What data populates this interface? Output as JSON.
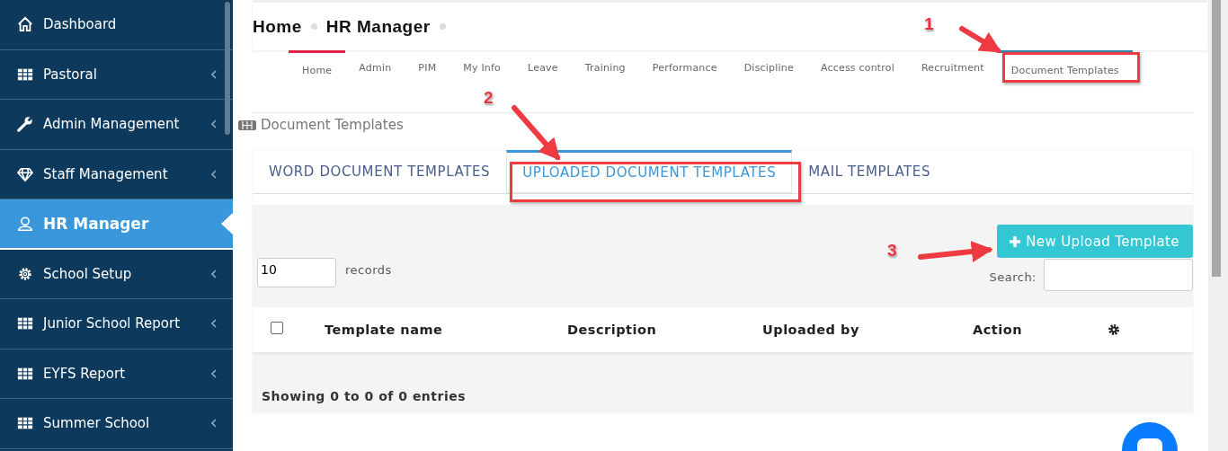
{
  "sidebar": {
    "items": [
      {
        "label": "Dashboard",
        "kind": "home",
        "expandable": false,
        "selected": false
      },
      {
        "label": "Pastoral",
        "kind": "grid",
        "expandable": true,
        "selected": false
      },
      {
        "label": "Admin Management",
        "kind": "wrench",
        "expandable": true,
        "selected": false
      },
      {
        "label": "Staff Management",
        "kind": "diamond",
        "expandable": true,
        "selected": false
      },
      {
        "label": "HR Manager",
        "kind": "user",
        "expandable": false,
        "selected": true
      },
      {
        "label": "School Setup",
        "kind": "gear",
        "expandable": true,
        "selected": false
      },
      {
        "label": "Junior School Report",
        "kind": "grid",
        "expandable": true,
        "selected": false
      },
      {
        "label": "EYFS Report",
        "kind": "grid",
        "expandable": true,
        "selected": false
      },
      {
        "label": "Summer School",
        "kind": "grid",
        "expandable": true,
        "selected": false
      }
    ]
  },
  "breadcrumb": [
    "Home",
    "HR Manager"
  ],
  "nav_tabs": [
    {
      "label": "Home",
      "accent": true,
      "selected": false
    },
    {
      "label": "Admin",
      "accent": false,
      "selected": false
    },
    {
      "label": "PIM",
      "accent": false,
      "selected": false
    },
    {
      "label": "My Info",
      "accent": false,
      "selected": false
    },
    {
      "label": "Leave",
      "accent": false,
      "selected": false
    },
    {
      "label": "Training",
      "accent": false,
      "selected": false
    },
    {
      "label": "Performance",
      "accent": false,
      "selected": false
    },
    {
      "label": "Discipline",
      "accent": false,
      "selected": false
    },
    {
      "label": "Access control",
      "accent": false,
      "selected": false
    },
    {
      "label": "Recruitment",
      "accent": false,
      "selected": false
    },
    {
      "label": "Document Templates",
      "accent": false,
      "selected": true
    }
  ],
  "section_title": "Document Templates",
  "tabs": [
    {
      "label": "WORD DOCUMENT TEMPLATES",
      "selected": false
    },
    {
      "label": "UPLOADED DOCUMENT TEMPLATES",
      "selected": true
    },
    {
      "label": "MAIL TEMPLATES",
      "selected": false
    }
  ],
  "page_length": {
    "value": "10",
    "label": "records"
  },
  "new_button": "New Upload Template",
  "search": {
    "label": "Search:"
  },
  "table": {
    "select_all_checked": false,
    "columns": [
      "Template name",
      "Description",
      "Uploaded by",
      "Action"
    ]
  },
  "info": "Showing 0 to 0 of 0 entries",
  "annotations": [
    {
      "number": "1"
    },
    {
      "number": "2"
    },
    {
      "number": "3"
    }
  ]
}
